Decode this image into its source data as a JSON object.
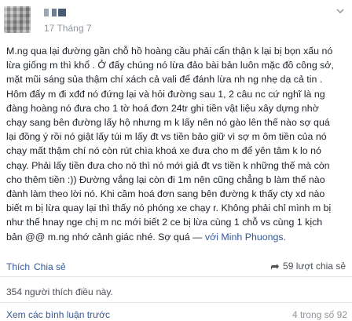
{
  "header": {
    "date": "17 Tháng 7"
  },
  "icons": {
    "avatar": "avatar",
    "chevron": "chevron-down-icon",
    "share": "share-icon"
  },
  "post": {
    "lines": [
      "M.ng qua lại đường gần chỗ hồ hoàng cầu phải cẩn thận k lại bị bọn xấu nó",
      "lừa giống m thì khổ . Ở đấy chúng nó lừa đảo bài bản luôn mặc đồ công sở,",
      "mặt mũi sáng sủa thậm chí xách cả vali để đánh lừa nh ng nhẹ dạ cả tin .",
      "Hôm đấy m đi xđđ nó đứng lại và hỏi đường sau 1, 2 câu nc cứ nghĩ là ng",
      "đàng hoàng nó đưa cho 1 tờ hoá đơn 24tr ghi tiền vật liệu xây dựng nhờ",
      "chạy sang bên đường lấy hộ nhưng m k lấy nên nó gào lên thế nào sợ quá",
      "lại đồng ý rồi nó giật lấy túi m lấy đt vs tiền bảo giữ vì sợ m ôm tiền của nó",
      "chạy mất thậm chí nó còn rút chìa khoá xe đưa cho m để yên tâm k lo nó",
      "chạy. Phải lấy tiền đưa cho nó thì nó mới giả đt vs tiền k những thế mà còn",
      "cho thêm tiền :)) Đường vắng lại còn đi 1m nên cũng chẳng b làm thế nào",
      "đành làm theo lời nó. Khi cầm hoá đơn sang bên đường k thấy cty xd nào",
      "biết m bị lừa quay lại thì thấy nó phóng xe chạy r. Không phải chỉ mình m bị",
      "như thế hnay nge chị m nc mới biết 2 ce bị lừa cùng 1 chỗ vs cùng 1 kịch"
    ],
    "last_line_text": "bản @@ m.ng nhớ cảnh giác nhé. Sợ quá — ",
    "tagged": "với Minh Phuongs."
  },
  "actions": {
    "like_label": "Thích",
    "separator": "·",
    "share_label": "Chia sẻ",
    "shares_count": "59 lượt chia sẻ"
  },
  "likes": {
    "text": "354 người thích điều này."
  },
  "comments": {
    "view_more": "Xem các bình luận trước",
    "count": "4 trong số 92"
  },
  "colors": {
    "link": "#365899",
    "text": "#1d2129",
    "muted": "#90949c"
  }
}
